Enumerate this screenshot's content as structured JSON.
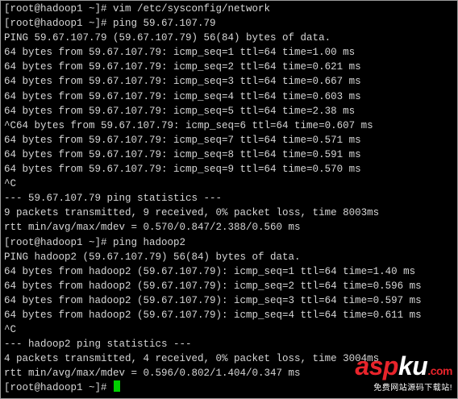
{
  "terminal": {
    "lines": [
      "[root@hadoop1 ~]# vim /etc/sysconfig/network",
      "[root@hadoop1 ~]# ping 59.67.107.79",
      "PING 59.67.107.79 (59.67.107.79) 56(84) bytes of data.",
      "64 bytes from 59.67.107.79: icmp_seq=1 ttl=64 time=1.00 ms",
      "64 bytes from 59.67.107.79: icmp_seq=2 ttl=64 time=0.621 ms",
      "64 bytes from 59.67.107.79: icmp_seq=3 ttl=64 time=0.667 ms",
      "64 bytes from 59.67.107.79: icmp_seq=4 ttl=64 time=0.603 ms",
      "64 bytes from 59.67.107.79: icmp_seq=5 ttl=64 time=2.38 ms",
      "^C64 bytes from 59.67.107.79: icmp_seq=6 ttl=64 time=0.607 ms",
      "64 bytes from 59.67.107.79: icmp_seq=7 ttl=64 time=0.571 ms",
      "64 bytes from 59.67.107.79: icmp_seq=8 ttl=64 time=0.591 ms",
      "64 bytes from 59.67.107.79: icmp_seq=9 ttl=64 time=0.570 ms",
      "^C",
      "--- 59.67.107.79 ping statistics ---",
      "9 packets transmitted, 9 received, 0% packet loss, time 8003ms",
      "rtt min/avg/max/mdev = 0.570/0.847/2.388/0.560 ms",
      "[root@hadoop1 ~]# ping hadoop2",
      "PING hadoop2 (59.67.107.79) 56(84) bytes of data.",
      "64 bytes from hadoop2 (59.67.107.79): icmp_seq=1 ttl=64 time=1.40 ms",
      "64 bytes from hadoop2 (59.67.107.79): icmp_seq=2 ttl=64 time=0.596 ms",
      "64 bytes from hadoop2 (59.67.107.79): icmp_seq=3 ttl=64 time=0.597 ms",
      "64 bytes from hadoop2 (59.67.107.79): icmp_seq=4 ttl=64 time=0.611 ms",
      "^C",
      "--- hadoop2 ping statistics ---",
      "4 packets transmitted, 4 received, 0% packet loss, time 3004ms",
      "rtt min/avg/max/mdev = 0.596/0.802/1.404/0.347 ms",
      "[root@hadoop1 ~]# "
    ],
    "background_color": "#000000",
    "text_color": "#d6d6d6",
    "cursor_color": "#00d000"
  },
  "watermark": {
    "logo_part1": "asp",
    "logo_part2": "ku",
    "logo_suffix": ".com",
    "tagline": "免费网站源码下载站!"
  }
}
